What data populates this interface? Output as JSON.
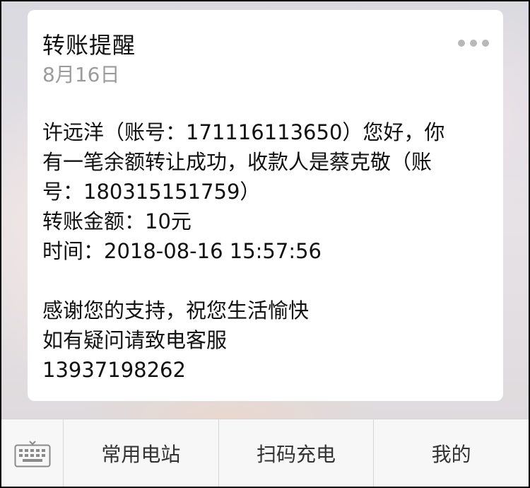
{
  "card": {
    "title": "转账提醒",
    "date": "8月16日",
    "more_icon": "more-dots-icon",
    "body_lines": [
      "许远洋（账号：171116113650）您好，你",
      "有一笔余额转让成功，收款人是蔡克敬（账",
      "号：180315151759）",
      "转账金额：10元",
      "时间：2018-08-16 15:57:56",
      "",
      "感谢您的支持，祝您生活愉快",
      "如有疑问请致电客服",
      "13937198262"
    ]
  },
  "bottom_menu": {
    "keyboard_icon": "keyboard-icon",
    "items": [
      {
        "label": "常用电站"
      },
      {
        "label": "扫码充电"
      },
      {
        "label": "我的"
      }
    ]
  }
}
